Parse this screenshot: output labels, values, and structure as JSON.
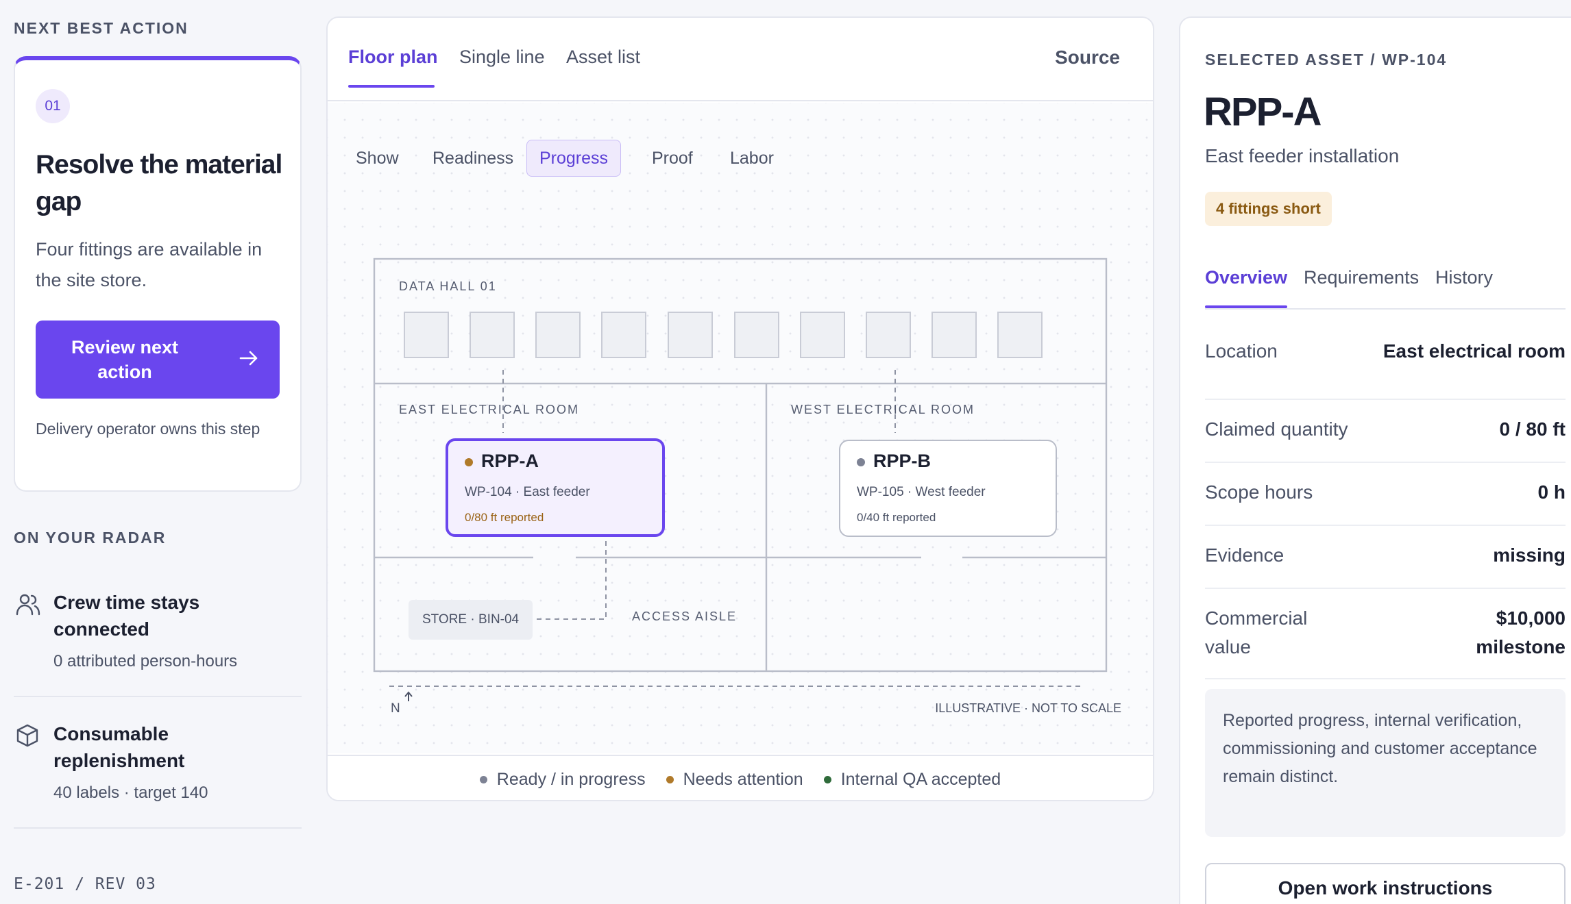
{
  "left": {
    "next_best_action_title": "NEXT BEST ACTION",
    "action": {
      "step": "01",
      "title": "Resolve the material gap",
      "description": "Four fittings are available in the site store.",
      "button_label": "Review next action",
      "owner_note": "Delivery operator owns this step"
    },
    "radar_title": "ON YOUR RADAR",
    "radar_items": [
      {
        "icon": "people-icon",
        "title": "Crew time stays connected",
        "subtitle": "0 attributed person-hours"
      },
      {
        "icon": "box-icon",
        "title": "Consumable replenishment",
        "subtitle": "40 labels · target 140"
      }
    ],
    "doc_ref": "E-201 / REV 03"
  },
  "center": {
    "tabs": [
      {
        "label": "Floor plan",
        "active": true
      },
      {
        "label": "Single line",
        "active": false
      },
      {
        "label": "Asset list",
        "active": false
      }
    ],
    "source_label": "Source",
    "show_label": "Show",
    "chips": [
      {
        "label": "Readiness",
        "active": false
      },
      {
        "label": "Progress",
        "active": true
      },
      {
        "label": "Proof",
        "active": false
      },
      {
        "label": "Labor",
        "active": false
      }
    ],
    "floorplan": {
      "data_hall_label": "DATA HALL 01",
      "east_room_label": "EAST ELECTRICAL ROOM",
      "west_room_label": "WEST ELECTRICAL ROOM",
      "access_aisle_label": "ACCESS AISLE",
      "store_label": "STORE · BIN-04",
      "north_label": "N",
      "scale_note": "ILLUSTRATIVE · NOT TO SCALE",
      "assets": [
        {
          "name": "RPP-A",
          "package": "WP-104 · East feeder",
          "progress": "0/80 ft reported",
          "selected": true,
          "dot_color": "#b07a2a"
        },
        {
          "name": "RPP-B",
          "package": "WP-105 · West feeder",
          "progress": "0/40 ft reported",
          "selected": false,
          "dot_color": "#7d8294"
        }
      ]
    },
    "legend": [
      {
        "label": "Ready / in progress",
        "color": "#7d8294"
      },
      {
        "label": "Needs attention",
        "color": "#b07a2a"
      },
      {
        "label": "Internal QA accepted",
        "color": "#2f6b3a"
      }
    ]
  },
  "right": {
    "selected_label": "SELECTED ASSET / WP-104",
    "title": "RPP-A",
    "subtitle": "East feeder installation",
    "status_badge": "4 fittings short",
    "tabs": [
      {
        "label": "Overview",
        "active": true
      },
      {
        "label": "Requirements",
        "active": false
      },
      {
        "label": "History",
        "active": false
      }
    ],
    "details": [
      {
        "key": "Location",
        "value": "East electrical room"
      },
      {
        "key": "Claimed quantity",
        "value": "0 / 80 ft"
      },
      {
        "key": "Scope hours",
        "value": "0 h"
      },
      {
        "key": "Evidence",
        "value": "missing"
      },
      {
        "key": "Commercial value",
        "value": "$10,000 milestone"
      }
    ],
    "note": "Reported progress, internal verification, commissioning and customer acceptance remain distinct.",
    "open_button": "Open work instructions"
  },
  "colors": {
    "accent": "#6a46ee",
    "attention": "#b07a2a",
    "accepted": "#2f6b3a",
    "neutral": "#7d8294"
  }
}
